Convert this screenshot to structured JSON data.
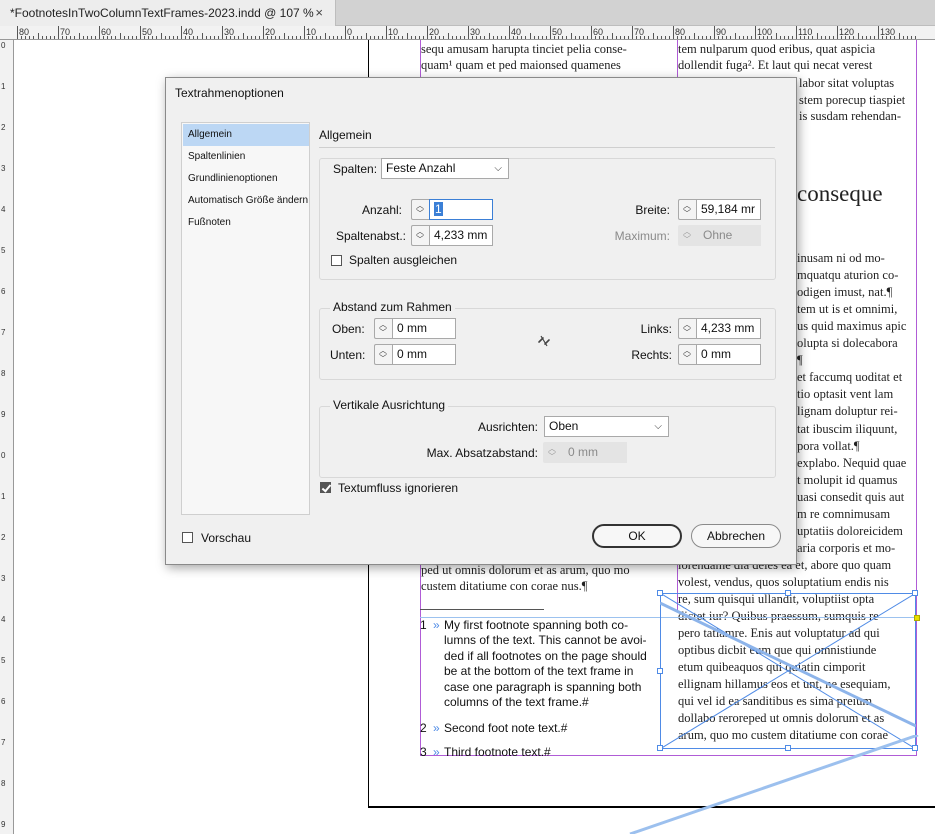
{
  "tab": {
    "title": "*FootnotesInTwoColumnTextFrames-2023.indd @ 107 %",
    "close_glyph": "×"
  },
  "ruler": {
    "h_labels": [
      "80",
      "70",
      "60",
      "50",
      "40",
      "30",
      "20",
      "10",
      "0",
      "10",
      "20",
      "30",
      "40",
      "50",
      "60",
      "70",
      "80",
      "90",
      "100",
      "110",
      "120",
      "130"
    ],
    "v_labels": [
      "0",
      "1",
      "2",
      "3",
      "4",
      "5",
      "6",
      "7",
      "8",
      "9",
      "0",
      "1",
      "2",
      "3",
      "4",
      "5",
      "6",
      "7",
      "8",
      "9"
    ]
  },
  "page": {
    "left_col_top": [
      "sequ amusam harupta tinciet pelia conse-",
      "quam¹ quam et ped maionsed quamenes"
    ],
    "right_col_top": [
      "tem nulparum quod eribus, quat aspicia",
      "dollendit fuga². Et laut qui necat verest",
      "labor sitat voluptas",
      "stem porecup tiaspiet",
      "is susdam rehendan-"
    ],
    "heading_fragment": "conseque",
    "right_col_mid": [
      "inusam ni od mo-",
      "mquatqu aturion co-",
      "odigen imust, nat.¶",
      "tem ut is et omnimi,",
      "us quid maximus apic",
      "olupta si dolecabora",
      "¶",
      "et faccumq uoditat et",
      "tio optasit vent lam",
      "lignam doluptur rei-",
      "tat ibuscim iliquunt,",
      "pora vollat.¶",
      "explabo. Nequid quae",
      "t molupit id quamus",
      "uasi consedit quis aut",
      "m re comnimusam",
      "uptatiis doloreicidem",
      "aria corporis et mo-",
      "lorendame dia deles ea et, abore quo quam",
      "volest, vendus, quos soluptatium endis nis",
      "re, sum quisqui ullandit, voluptiist opta",
      "dictet iur? Quibus praessum, sumquis re",
      "pero tatiamre. Enis aut voluptatur ad qui",
      "optibus dicbit eum que qui omnistiunde",
      "etum quibeaquos qui quiatin cimporit",
      "ellignam hillamus eos et unt, ne esequiam,",
      "qui vel id ea sanditibus es sima preium",
      "dollabo reroreped ut omnis dolorum et as",
      "arum, quo mo custem ditatiume con corae"
    ],
    "left_col_bottom": [
      "ped ut omnis dolorum et as arum, quo mo",
      "custem ditatiume con corae nus.¶"
    ],
    "footnotes": [
      {
        "num": "1",
        "lines": [
          "My first footnote spanning both co-",
          "lumns of the text. This cannot be avoi-",
          "ded if all footnotes on the page should",
          "be at the bottom of the text frame in",
          "case one paragraph is spanning both",
          "columns of the text frame.#"
        ]
      },
      {
        "num": "2",
        "lines": [
          "Second foot note text.#"
        ]
      },
      {
        "num": "3",
        "lines": [
          "Third footnote text.#"
        ]
      }
    ],
    "fn_arrow": "»"
  },
  "dialog": {
    "title": "Textrahmenoptionen",
    "sidebar": [
      "Allgemein",
      "Spaltenlinien",
      "Grundlinienoptionen",
      "Automatisch Größe ändern",
      "Fußnoten"
    ],
    "panel_title": "Allgemein",
    "spalten": {
      "label": "Spalten:",
      "select_value": "Feste Anzahl",
      "anzahl_label": "Anzahl:",
      "anzahl_value": "1",
      "abst_label": "Spaltenabst.:",
      "abst_value": "4,233 mm",
      "breite_label": "Breite:",
      "breite_value": "59,184 mr",
      "max_label": "Maximum:",
      "max_value": "Ohne",
      "balance_label": "Spalten ausgleichen"
    },
    "abstand": {
      "title": "Abstand zum Rahmen",
      "oben_label": "Oben:",
      "oben_value": "0 mm",
      "unten_label": "Unten:",
      "unten_value": "0 mm",
      "links_label": "Links:",
      "links_value": "4,233 mm",
      "rechts_label": "Rechts:",
      "rechts_value": "0 mm"
    },
    "vertikal": {
      "title": "Vertikale Ausrichtung",
      "ausrichten_label": "Ausrichten:",
      "ausrichten_value": "Oben",
      "max_label": "Max. Absatzabstand:",
      "max_value": "0 mm"
    },
    "ignore_wrap_label": "Textumfluss ignorieren",
    "preview_label": "Vorschau",
    "ok_label": "OK",
    "cancel_label": "Abbrechen"
  },
  "colors": {
    "accent_select": "#bcd7f4",
    "frame_purple": "#b05cd6",
    "frame_blue": "#4f8be6"
  }
}
